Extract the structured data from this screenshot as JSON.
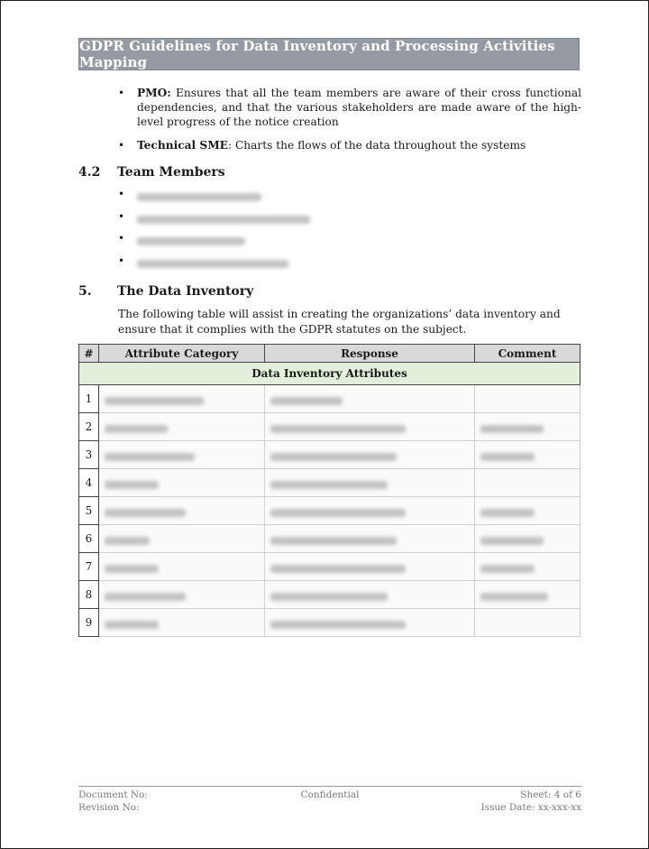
{
  "header": {
    "title": "GDPR Guidelines for Data Inventory and Processing Activities Mapping"
  },
  "roles": [
    {
      "label": "PMO:",
      "text": " Ensures that all the team members are aware of their cross functional dependencies, and that the various stakeholders are made aware of the high-level progress of the notice creation"
    },
    {
      "label": "Technical SME",
      "text": ": Charts the flows of the data throughout the systems"
    }
  ],
  "section_4_2": {
    "number": "4.2",
    "title": "Team Members",
    "member_count_blurred": 4
  },
  "section_5": {
    "number": "5.",
    "title": "The Data Inventory",
    "intro": "The following table will assist in creating the organizations’ data inventory and ensure that it complies with the GDPR statutes on the subject."
  },
  "table": {
    "headers": [
      "#",
      "Attribute Category",
      "Response",
      "Comment"
    ],
    "section_row": "Data Inventory Attributes",
    "row_numbers": [
      "1",
      "2",
      "3",
      "4",
      "5",
      "6",
      "7",
      "8",
      "9"
    ],
    "cell_content": "blurred",
    "header_bg": "#d9d9d9",
    "section_bg": "#e2efda"
  },
  "footer": {
    "document_no": "Document No:",
    "revision_no": "Revision No:",
    "classification": "Confidential",
    "sheet": "Sheet: 4 of 6",
    "issue_date": "Issue Date: xx-xxx-xx"
  },
  "colors": {
    "title_bar": "#959aa3"
  }
}
